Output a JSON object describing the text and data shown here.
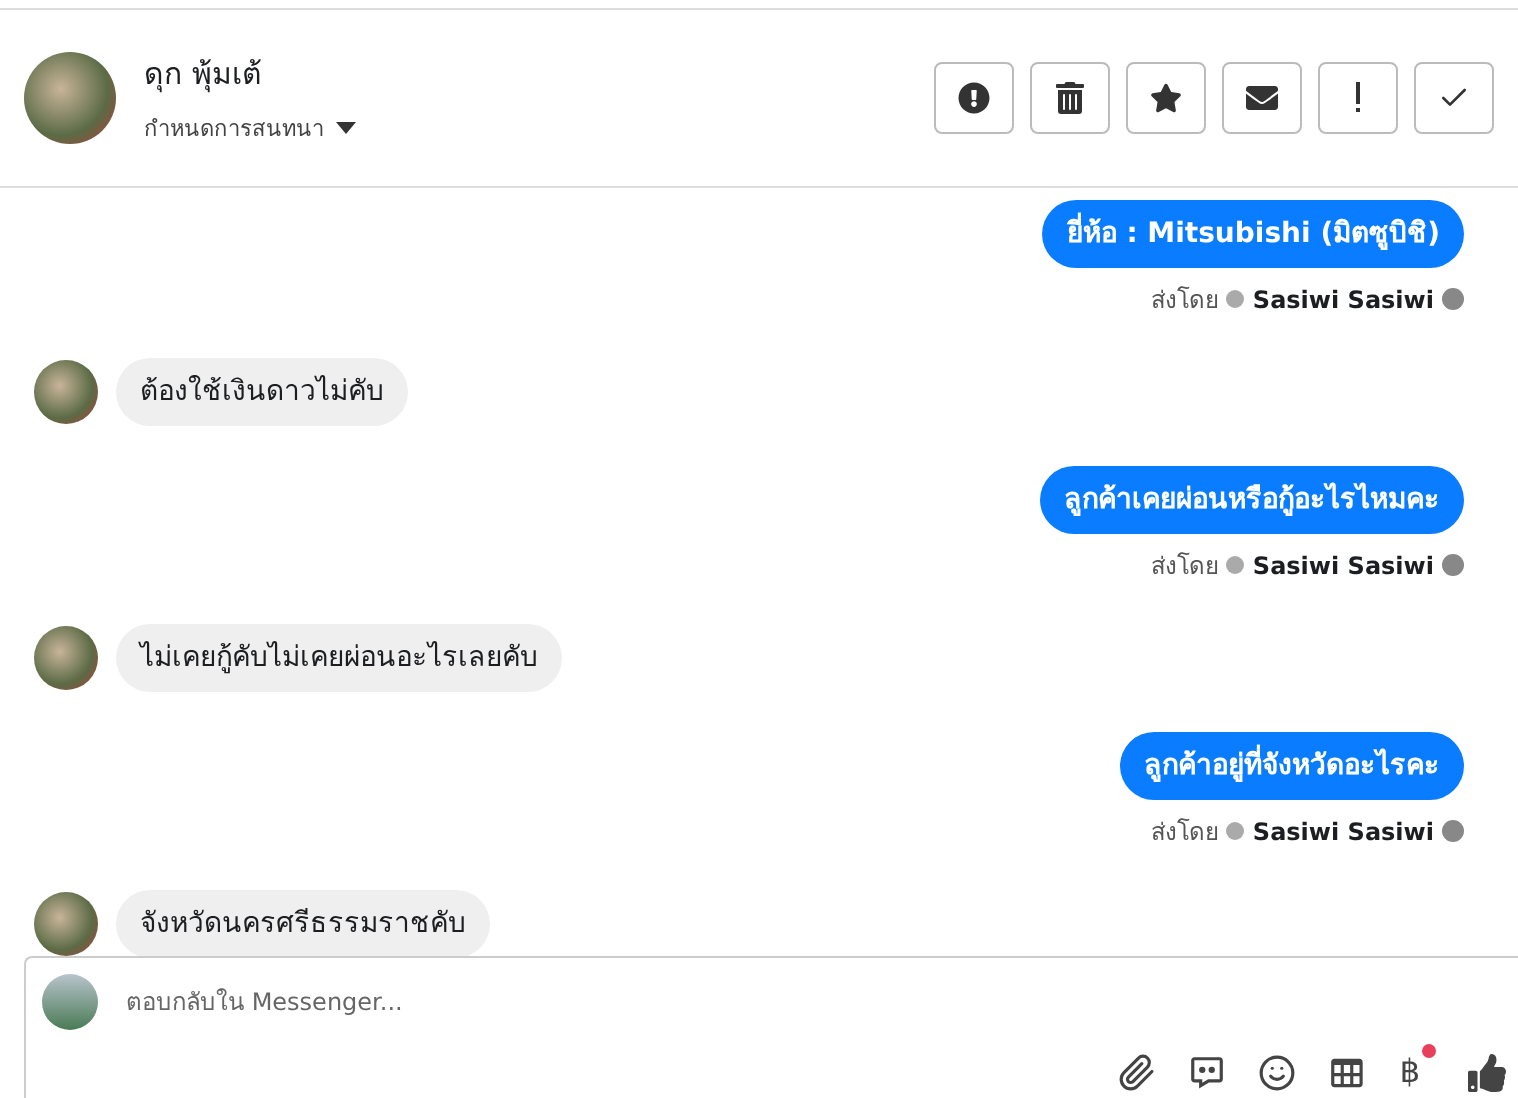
{
  "contact": {
    "name": "ดุก พุ้มเต้",
    "subtitle": "กำหนดการสนทนา"
  },
  "messages": [
    {
      "kind": "outgoing",
      "text": "ยี่ห้อ : Mitsubishi (มิตซูบิชิ)",
      "sent_by": "ส่งโดย",
      "sender": "Sasiwi Sasiwi"
    },
    {
      "kind": "incoming",
      "text": "ต้องใช้เงินดาวไม่คับ"
    },
    {
      "kind": "outgoing",
      "text": "ลูกค้าเคยผ่อนหรือกู้อะไรไหมคะ",
      "sent_by": "ส่งโดย",
      "sender": "Sasiwi Sasiwi"
    },
    {
      "kind": "incoming",
      "text": "ไม่เคยกู้คับไม่เคยผ่อนอะไรเลยคับ"
    },
    {
      "kind": "outgoing",
      "text": "ลูกค้าอยู่ที่จังหวัดอะไรคะ",
      "sent_by": "ส่งโดย",
      "sender": "Sasiwi Sasiwi"
    },
    {
      "kind": "incoming",
      "text": "จังหวัดนครศรีธรรมราชคับ"
    }
  ],
  "composer": {
    "placeholder": "ตอบกลับใน Messenger...",
    "payment_symbol": "฿"
  }
}
